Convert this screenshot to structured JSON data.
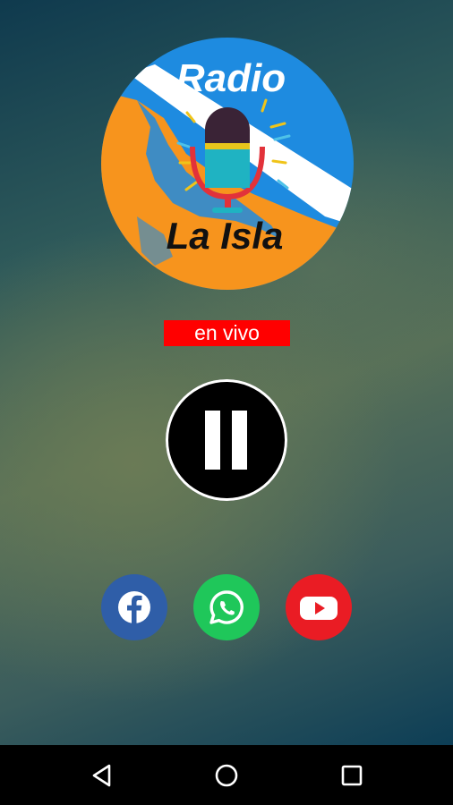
{
  "logo": {
    "title_top": "Radio",
    "title_bottom": "La Isla",
    "colors": {
      "circle_blue": "#1e8be0",
      "orange": "#f7941d",
      "white_band": "#ffffff"
    }
  },
  "status": {
    "live_label": "en vivo",
    "badge_color": "#ff0000"
  },
  "player": {
    "state": "playing",
    "control_icon": "pause-icon"
  },
  "social": [
    {
      "name": "facebook",
      "icon": "facebook-icon",
      "color": "#2f5ea8"
    },
    {
      "name": "whatsapp",
      "icon": "whatsapp-icon",
      "color": "#1fc75a"
    },
    {
      "name": "youtube",
      "icon": "youtube-icon",
      "color": "#ea1c24"
    }
  ],
  "navbar": {
    "buttons": [
      "back-icon",
      "home-icon",
      "recent-apps-icon"
    ]
  }
}
